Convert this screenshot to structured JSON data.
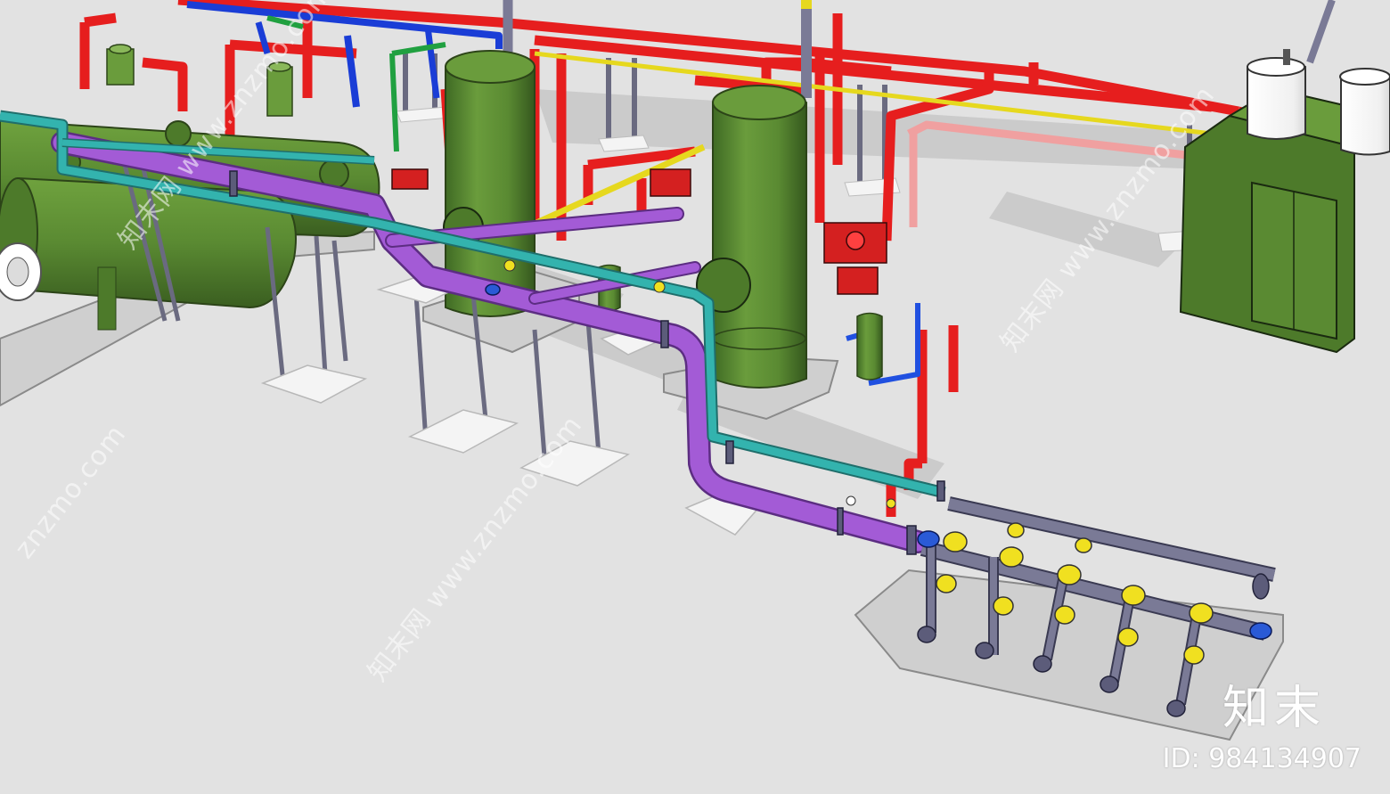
{
  "watermark": {
    "brand": "知末",
    "id_text": "ID: 984134907",
    "diagonal_text": "知末网 www.znzmo.com",
    "diagonal_short": "znzmo.com"
  },
  "colors": {
    "ground": "#e2e2e2",
    "vessel_green": "#5a8a32",
    "vessel_green_dark": "#3f6622",
    "pipe_purple": "#a35bd6",
    "pipe_cyan": "#33b3ae",
    "pipe_red": "#e61e1e",
    "pipe_blue": "#1a3dd6",
    "pipe_yellow": "#e6d81e",
    "pipe_pink": "#f0a0a0",
    "pipe_grey": "#7a7a96",
    "valve_yellow": "#f0e020",
    "valve_blue": "#2a5ad6",
    "tank_white": "#fafafa",
    "pad_white": "#f4f4f4"
  }
}
